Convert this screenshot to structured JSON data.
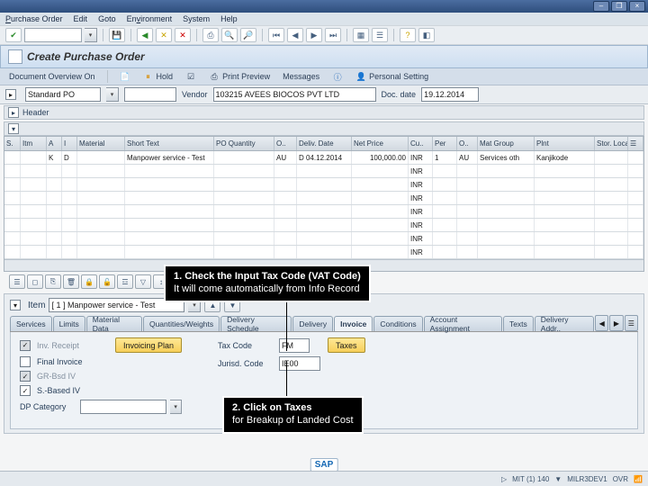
{
  "title_buttons": [
    "–",
    "❐",
    "×"
  ],
  "menu": {
    "po": "Purchase Order",
    "edit": "Edit",
    "goto": "Goto",
    "env": "Environment",
    "system": "System",
    "help": "Help"
  },
  "subtitle": "Create Purchase Order",
  "app_toolbar": {
    "overview": "Document Overview On",
    "hold": "Hold",
    "preview": "Print Preview",
    "messages": "Messages",
    "personal": "Personal Setting"
  },
  "doc_header": {
    "type": "Standard PO",
    "vendor_label": "Vendor",
    "vendor": "103215 AVEES BIOCOS PVT LTD",
    "docdate_label": "Doc. date",
    "docdate": "19.12.2014"
  },
  "header_section": "Header",
  "grid_cols": [
    "S.",
    "Itm",
    "A",
    "I",
    "Material",
    "Short Text",
    "PO Quantity",
    "O..",
    "Deliv. Date",
    "Net Price",
    "Cu..",
    "Per",
    "O..",
    "Mat Group",
    "Plnt",
    "Stor. Locat.."
  ],
  "grid_row": {
    "s": "",
    "itm": "",
    "a": "K",
    "i": "D",
    "mat": "",
    "short": "Manpower service - Test",
    "qty": "",
    "ou": "AU",
    "deliv": "D 04.12.2014",
    "price": "100,000.00",
    "cur": "INR",
    "per": "1",
    "ou2": "AU",
    "matgrp": "Services oth",
    "plnt": "Kanjikode",
    "stor": ""
  },
  "empty_cur": "INR",
  "item_detail_label": "Item",
  "item_value": "[ 1 ] Manpower service - Test",
  "tabs": {
    "services": "Services",
    "limits": "Limits",
    "material": "Material Data",
    "qty": "Quantities/Weights",
    "delsched": "Delivery Schedule",
    "delivery": "Delivery",
    "invoice": "Invoice",
    "cond": "Conditions",
    "acct": "Account Assignment",
    "texts": "Texts",
    "deladdr": "Delivery Addr.."
  },
  "invoice": {
    "inv_receipt": "Inv. Receipt",
    "invoicing_plan": "Invoicing Plan",
    "final": "Final Invoice",
    "gr": "GR-Bsd IV",
    "ers": "S.-Based IV",
    "dpcat": "DP Category",
    "taxcode_label": "Tax Code",
    "taxcode": "FM",
    "taxes_btn": "Taxes",
    "juris_label": "Jurisd. Code",
    "juris": "IE00"
  },
  "ann1": {
    "line1": "1. Check the Input Tax Code (VAT Code)",
    "line2": "    It will come automatically from Info Record"
  },
  "ann2": {
    "line1": "2. Click on Taxes",
    "line2": "    for Breakup of Landed Cost"
  },
  "status": {
    "client": "MIT (1) 140",
    "user": "MILR3DEV1",
    "mode": "OVR"
  }
}
